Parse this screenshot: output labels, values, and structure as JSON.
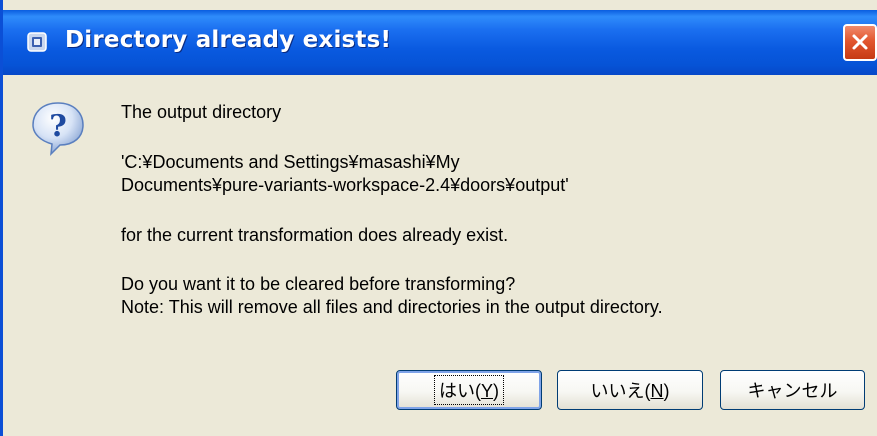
{
  "window": {
    "title": "Directory already exists!",
    "title_icon": "java-app-icon",
    "close_icon": "close-x-icon",
    "accent_color": "#0a5ae0",
    "close_color": "#e2562f"
  },
  "dialog": {
    "icon": "question-icon",
    "lines": [
      "The output directory",
      "'C:¥Documents and Settings¥masashi¥My",
      "Documents¥pure-variants-workspace-2.4¥doors¥output'",
      "for the current transformation does already exist.",
      "Do you want it to be cleared before transforming?",
      "Note: This will remove all files and directories in the output directory."
    ]
  },
  "buttons": {
    "yes": {
      "prefix": "はい(",
      "mnemonic": "Y",
      "suffix": ")"
    },
    "no": {
      "prefix": "いいえ(",
      "mnemonic": "N",
      "suffix": ")"
    },
    "cancel": {
      "label": "キャンセル"
    }
  }
}
